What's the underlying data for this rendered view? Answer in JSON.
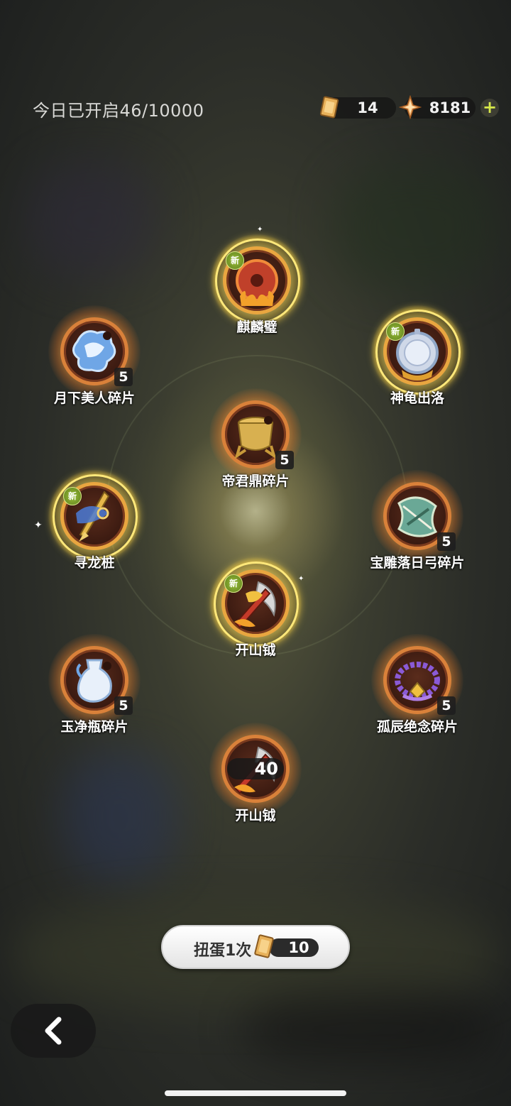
{
  "header": {
    "opened_today": "今日已开启46/10000",
    "ticket_count": "14",
    "crystal_count": "8181",
    "plus_icon": "plus-icon"
  },
  "items": [
    {
      "id": "qilin",
      "name": "麒麟璧",
      "new_badge": "新",
      "rarity": "gold",
      "art_icon": "red-jade-disc-icon"
    },
    {
      "id": "moon",
      "name": "月下美人碎片",
      "count": "5",
      "rarity": "orange",
      "art_icon": "blue-flower-shard-icon"
    },
    {
      "id": "turtle",
      "name": "神龟出洛",
      "new_badge": "新",
      "rarity": "gold",
      "art_icon": "silver-compass-icon"
    },
    {
      "id": "cauldron",
      "name": "帝君鼎碎片",
      "count": "5",
      "rarity": "orange",
      "art_icon": "golden-cauldron-shard-icon"
    },
    {
      "id": "dragon",
      "name": "寻龙桩",
      "new_badge": "新",
      "rarity": "gold",
      "art_icon": "blue-spear-icon"
    },
    {
      "id": "bow",
      "name": "宝雕落日弓碎片",
      "count": "5",
      "rarity": "orange",
      "art_icon": "jade-bow-shard-icon"
    },
    {
      "id": "axe",
      "name": "开山钺",
      "new_badge": "新",
      "rarity": "gold",
      "art_icon": "golden-axe-icon"
    },
    {
      "id": "vase",
      "name": "玉净瓶碎片",
      "count": "5",
      "rarity": "orange",
      "art_icon": "white-vase-shard-icon"
    },
    {
      "id": "beads",
      "name": "孤辰绝念碎片",
      "count": "5",
      "rarity": "orange",
      "art_icon": "purple-beads-shard-icon"
    },
    {
      "id": "axe2",
      "name": "开山钺",
      "count": "40",
      "rarity": "orange",
      "art_icon": "golden-axe-icon"
    }
  ],
  "draw_button": {
    "label": "扭蛋1次",
    "cost": "10",
    "icon": "ticket-icon"
  },
  "nav": {
    "back_icon": "chevron-left-icon"
  },
  "colors": {
    "orange_rim": "#d9813a",
    "gold_ring": "#ffe87a",
    "new_badge": "#7fa12b"
  }
}
